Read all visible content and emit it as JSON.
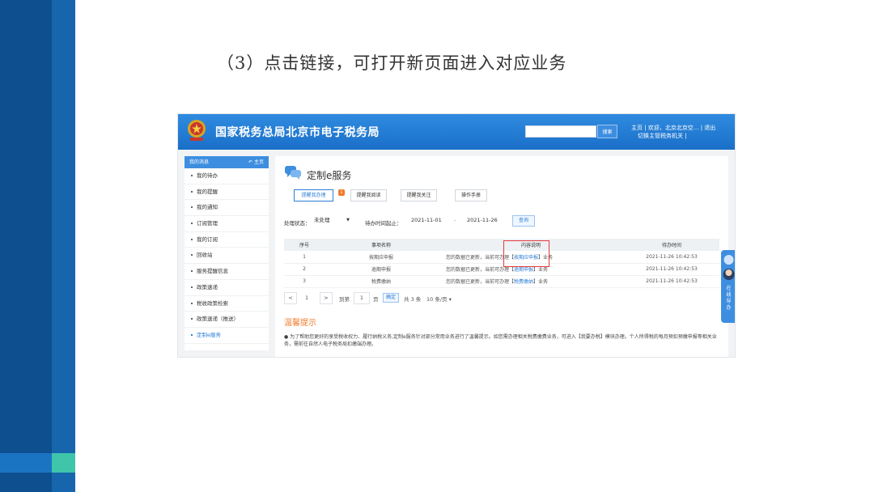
{
  "slide": {
    "title": "（3）点击链接，可打开新页面进入对应业务"
  },
  "site": {
    "title": "国家税务总局北京市电子税务局",
    "search_button": "搜索",
    "nav_line1": "主页 | 欢迎，北京北京空... | 退出",
    "nav_line2": "切换主管税务机关 |"
  },
  "sidebar": {
    "header": "我的消息",
    "home_label": "主页",
    "items": [
      {
        "label": "我的待办"
      },
      {
        "label": "我的提醒"
      },
      {
        "label": "我的通知"
      },
      {
        "label": "订阅管理"
      },
      {
        "label": "我的订阅"
      },
      {
        "label": "回收站"
      },
      {
        "label": "服务提醒信息"
      },
      {
        "label": "政策速递"
      },
      {
        "label": "税收政策检索"
      },
      {
        "label": "政策速递（推送）"
      },
      {
        "label": "定制e服务"
      }
    ]
  },
  "main": {
    "title": "定制e服务",
    "tabs": [
      "提醒我办理",
      "提醒我阅读",
      "提醒我关注",
      "操作手册"
    ],
    "tab_badge": "1",
    "filter": {
      "status_label": "处理状态：",
      "status_value": "未处理",
      "time_label": "待办时间起止：",
      "date_from": "2021-11-01",
      "date_separator": "-",
      "date_to": "2021-11-26",
      "query_button": "查询"
    },
    "table": {
      "headers": [
        "序号",
        "事项名称",
        "内容说明",
        "待办时间"
      ],
      "rows": [
        {
          "no": "1",
          "name": "按期应申报",
          "desc_prefix": "您的数据已更新，当前可办理【",
          "link": "按期应申报",
          "desc_suffix": "】业务",
          "time": "2021-11-26 10:42:53"
        },
        {
          "no": "2",
          "name": "逾期申报",
          "desc_prefix": "您的数据已更新，当前可办理【",
          "link": "逾期申报",
          "desc_suffix": "】业务",
          "time": "2021-11-26 10:42:53"
        },
        {
          "no": "3",
          "name": "税费缴纳",
          "desc_prefix": "您的数据已更新，当前可办理【",
          "link": "税费缴纳",
          "desc_suffix": "】业务",
          "time": "2021-11-26 10:42:53"
        }
      ]
    },
    "pager": {
      "prev": "<",
      "page": "1",
      "next": ">",
      "goto_label": "到第",
      "goto_value": "1",
      "page_unit": "页",
      "confirm": "确定",
      "total": "共 3 条",
      "page_size": "10 条/页"
    },
    "warm_tips": {
      "title": "温馨提示",
      "text": "● 为了帮助您更好的享受税收权力、履行纳税义务,定制e服务针对部分常用业务进行了温馨提示。如您需办理相关税费缴费业务，可进入【我要办税】模块办理。个人所得税的每月预扣预缴申报等相关业务，需前往自然人电子税务局扣缴端办理。"
    }
  },
  "float_service": {
    "label": "在线导办"
  },
  "colors": {
    "brand_blue": "#1a6fc8",
    "accent": "#2d7ed6",
    "orange": "#f07a2a",
    "highlight_red": "#e23b3b"
  }
}
